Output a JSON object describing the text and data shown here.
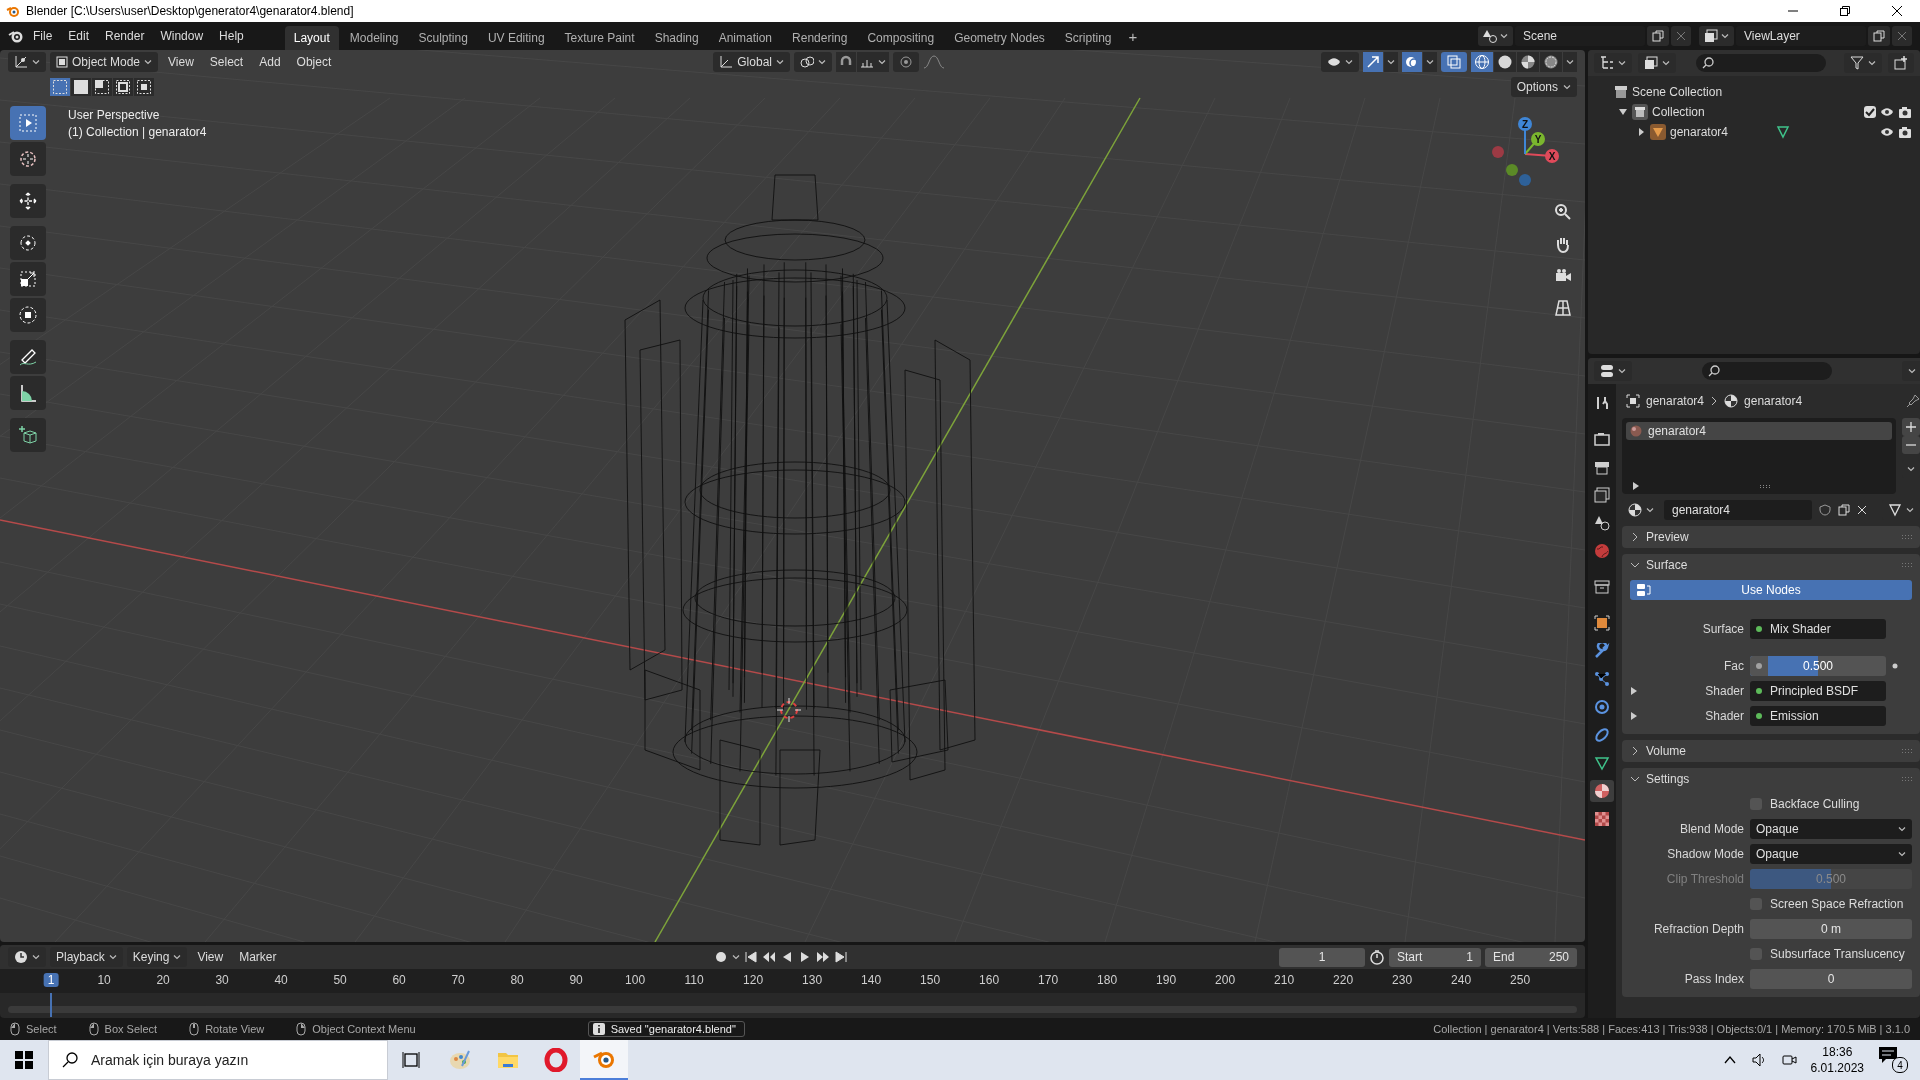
{
  "window": {
    "title": "Blender [C:\\Users\\user\\Desktop\\generator4\\genarator4.blend]"
  },
  "menu": [
    "File",
    "Edit",
    "Render",
    "Window",
    "Help"
  ],
  "workspaces": [
    {
      "label": "Layout",
      "selected": true
    },
    {
      "label": "Modeling",
      "selected": false
    },
    {
      "label": "Sculpting",
      "selected": false
    },
    {
      "label": "UV Editing",
      "selected": false
    },
    {
      "label": "Texture Paint",
      "selected": false
    },
    {
      "label": "Shading",
      "selected": false
    },
    {
      "label": "Animation",
      "selected": false
    },
    {
      "label": "Rendering",
      "selected": false
    },
    {
      "label": "Compositing",
      "selected": false
    },
    {
      "label": "Geometry Nodes",
      "selected": false
    },
    {
      "label": "Scripting",
      "selected": false
    }
  ],
  "add_workspace": "+",
  "scene": {
    "name": "Scene"
  },
  "view_layer": {
    "name": "ViewLayer"
  },
  "viewport": {
    "mode": "Object Mode",
    "menus": [
      "View",
      "Select",
      "Add",
      "Object"
    ],
    "orientation": "Global",
    "options": "Options",
    "info": [
      "User Perspective",
      "(1) Collection | genarator4"
    ],
    "select_modes": [
      {
        "kind": "set",
        "selected": true
      },
      {
        "kind": "extend",
        "selected": false
      },
      {
        "kind": "subtract",
        "selected": false
      },
      {
        "kind": "invert",
        "selected": false
      },
      {
        "kind": "intersect",
        "selected": false
      }
    ],
    "tools": [
      {
        "kind": "select",
        "selected": true
      },
      {
        "kind": "cursor",
        "selected": false
      },
      {
        "kind": "move",
        "selected": false
      },
      {
        "kind": "rotate",
        "selected": false
      },
      {
        "kind": "scale",
        "selected": false
      },
      {
        "kind": "transform",
        "selected": false
      },
      {
        "kind": "annotate",
        "selected": false
      },
      {
        "kind": "measure",
        "selected": false
      },
      {
        "kind": "add_cube",
        "selected": false
      }
    ],
    "gizmo_axes": [
      "X",
      "Y",
      "Z"
    ],
    "shading": [
      {
        "kind": "wireframe",
        "selected": true
      },
      {
        "kind": "solid",
        "selected": false
      },
      {
        "kind": "material",
        "selected": false
      },
      {
        "kind": "rendered",
        "selected": false
      }
    ]
  },
  "outliner": {
    "items": [
      {
        "label": "Scene Collection",
        "kind": "scene",
        "children": [
          {
            "label": "Collection",
            "kind": "collection",
            "expanded": true,
            "checked": true,
            "children": [
              {
                "label": "genarator4",
                "kind": "object",
                "expanded": false
              }
            ]
          }
        ]
      }
    ]
  },
  "properties": {
    "tabs": [
      {
        "kind": "tool",
        "selected": false
      },
      {
        "kind": "render",
        "selected": false
      },
      {
        "kind": "output",
        "selected": false
      },
      {
        "kind": "view_layer",
        "selected": false
      },
      {
        "kind": "scene",
        "selected": false
      },
      {
        "kind": "world",
        "selected": false
      },
      {
        "kind": "collection",
        "selected": false
      },
      {
        "kind": "object",
        "selected": false
      },
      {
        "kind": "modifier",
        "selected": false
      },
      {
        "kind": "particles",
        "selected": false
      },
      {
        "kind": "physics",
        "selected": false
      },
      {
        "kind": "constraints",
        "selected": false
      },
      {
        "kind": "data",
        "selected": false
      },
      {
        "kind": "material",
        "selected": true
      },
      {
        "kind": "texture",
        "selected": false
      }
    ],
    "breadcrumb": [
      "genarator4",
      "genarator4"
    ],
    "slots": [
      {
        "label": "genarator4",
        "selected": true
      }
    ],
    "material": "genarator4",
    "panels": [
      {
        "title": "Preview",
        "expanded": false
      },
      {
        "title": "Surface",
        "expanded": true,
        "button": "Use Nodes",
        "rows": [
          {
            "kind": "socket",
            "label": "Surface",
            "value": "Mix Shader",
            "color": "#5dba5a",
            "expandable": false,
            "disabled": false
          },
          {
            "kind": "slider",
            "label": "Fac",
            "value": "0.500",
            "level": 0.5,
            "color": "#a1a1a1",
            "expandable": false,
            "disabled": false
          },
          {
            "kind": "socket",
            "label": "Shader",
            "value": "Principled BSDF",
            "color": "#5dba5a",
            "expandable": true,
            "disabled": false
          },
          {
            "kind": "socket",
            "label": "Shader",
            "value": "Emission",
            "color": "#5dba5a",
            "expandable": true,
            "disabled": false
          }
        ]
      },
      {
        "title": "Volume",
        "expanded": false
      },
      {
        "title": "Settings",
        "expanded": true,
        "rows": [
          {
            "kind": "checkbox",
            "label": "Backface Culling",
            "checked": false,
            "disabled": false
          },
          {
            "kind": "dropdown",
            "label": "Blend Mode",
            "value": "Opaque",
            "disabled": false
          },
          {
            "kind": "dropdown",
            "label": "Shadow Mode",
            "value": "Opaque",
            "disabled": false
          },
          {
            "kind": "slider",
            "label": "Clip Threshold",
            "value": "0.500",
            "level": 0.5,
            "disabled": true
          },
          {
            "kind": "checkbox",
            "label": "Screen Space Refraction",
            "checked": false,
            "disabled": false
          },
          {
            "kind": "number",
            "label": "Refraction Depth",
            "value": "0 m",
            "disabled": false
          },
          {
            "kind": "checkbox",
            "label": "Subsurface Translucency",
            "checked": false,
            "disabled": false
          },
          {
            "kind": "number",
            "label": "Pass Index",
            "value": "0",
            "disabled": false
          }
        ]
      }
    ]
  },
  "timeline": {
    "menus": [
      {
        "label": "Playback",
        "kind": "dropdown"
      },
      {
        "label": "Keying",
        "kind": "dropdown"
      },
      {
        "label": "View",
        "kind": "menu"
      },
      {
        "label": "Marker",
        "kind": "menu"
      }
    ],
    "current_frame": "1",
    "start_label": "Start",
    "start": "1",
    "end_label": "End",
    "end": "250",
    "ruler": [
      {
        "label": "1",
        "selected": true
      },
      {
        "label": "10",
        "selected": false
      },
      {
        "label": "20",
        "selected": false
      },
      {
        "label": "30",
        "selected": false
      },
      {
        "label": "40",
        "selected": false
      },
      {
        "label": "50",
        "selected": false
      },
      {
        "label": "60",
        "selected": false
      },
      {
        "label": "70",
        "selected": false
      },
      {
        "label": "80",
        "selected": false
      },
      {
        "label": "90",
        "selected": false
      },
      {
        "label": "100",
        "selected": false
      },
      {
        "label": "110",
        "selected": false
      },
      {
        "label": "120",
        "selected": false
      },
      {
        "label": "130",
        "selected": false
      },
      {
        "label": "140",
        "selected": false
      },
      {
        "label": "150",
        "selected": false
      },
      {
        "label": "160",
        "selected": false
      },
      {
        "label": "170",
        "selected": false
      },
      {
        "label": "180",
        "selected": false
      },
      {
        "label": "190",
        "selected": false
      },
      {
        "label": "200",
        "selected": false
      },
      {
        "label": "210",
        "selected": false
      },
      {
        "label": "220",
        "selected": false
      },
      {
        "label": "230",
        "selected": false
      },
      {
        "label": "240",
        "selected": false
      },
      {
        "label": "250",
        "selected": false
      }
    ]
  },
  "status_bar": {
    "hints": [
      "Select",
      "Box Select",
      "Rotate View",
      "Object Context Menu"
    ],
    "message": "Saved \"genarator4.blend\"",
    "stats": "Collection | genarator4 | Verts:588 | Faces:413 | Tris:938 | Objects:0/1 | Memory: 170.5 MiB | 3.1.0"
  },
  "taskbar": {
    "search": {
      "placeholder": "Aramak için buraya yazın"
    },
    "apps": [
      {
        "kind": "paint",
        "selected": false
      },
      {
        "kind": "folder",
        "selected": false
      },
      {
        "kind": "browser",
        "selected": false
      },
      {
        "kind": "blender",
        "selected": true
      }
    ],
    "time": "18:36",
    "date": "6.01.2023",
    "notifications": "4"
  }
}
